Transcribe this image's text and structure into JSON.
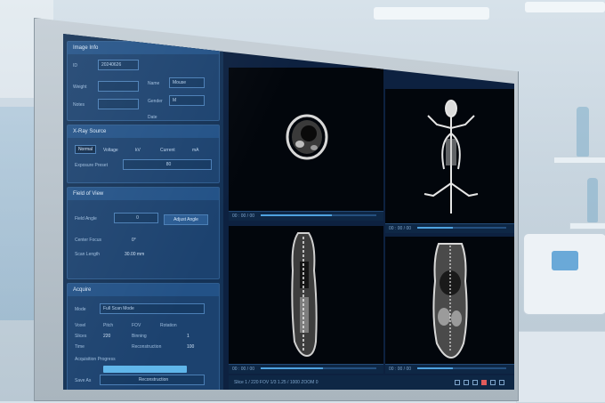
{
  "sidebar": {
    "image_info": {
      "title": "Image Info",
      "fields": [
        {
          "label": "ID",
          "value": "20240626"
        },
        {
          "label": "Name",
          "value": "Mouse"
        },
        {
          "label": "Gender",
          "value": "M"
        },
        {
          "label": "Weight",
          "value": ""
        },
        {
          "label": "Notes",
          "value": ""
        },
        {
          "label": "Date",
          "value": ""
        }
      ]
    },
    "xray_source": {
      "title": "X-Ray Source",
      "options": [
        "Normal",
        "Voltage",
        "kV",
        "Current",
        "mA"
      ],
      "selected": "Normal",
      "exposure_label": "Exposure Preset",
      "exposure_value": "80"
    },
    "field_of_view": {
      "title": "Field of View",
      "field_label": "Field Angle",
      "field_value": "0",
      "adjust_button": "Adjust Angle",
      "rows": [
        {
          "label": "Center Focus",
          "value": "0°"
        },
        {
          "label": "Scan Length",
          "value": "30.00 mm"
        }
      ]
    },
    "acquire": {
      "title": "Acquire",
      "mode_label": "Mode",
      "mode_value": "Full Scan Mode",
      "rows": [
        {
          "label": "Voxel",
          "value": "Pitch",
          "a": "FOV",
          "b": "Rotation"
        },
        {
          "label": "Slices",
          "value": "220",
          "a": "Binning",
          "b": "1"
        },
        {
          "label": "Time",
          "value": "",
          "a": "Reconstruction",
          "b": "100"
        }
      ],
      "progress_label": "Acquisition Progress",
      "progress": 0.78,
      "save_label": "Save As",
      "save_value": "Reconstruction"
    }
  },
  "viewports": [
    {
      "name": "axial",
      "bar_text": "00 : 00 / 00"
    },
    {
      "name": "top",
      "bar_text": "00 : 00 / 00"
    },
    {
      "name": "sagittal",
      "bar_text": "00 : 00 / 00"
    },
    {
      "name": "coronal",
      "bar_text": "00 : 00 / 00"
    }
  ],
  "status_bar": {
    "text": "Slice 1 / 220   FOV 1/3   1.25 / 1000   ZOOM 0"
  },
  "colors": {
    "accent": "#4fa3e0",
    "panel": "#1c426f",
    "background": "#0d2140",
    "tool_red": "#e05b5b"
  }
}
